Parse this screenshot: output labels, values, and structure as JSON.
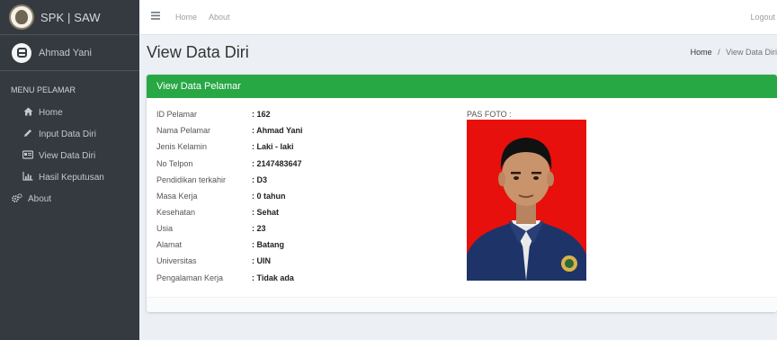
{
  "brand": {
    "title": "SPK | SAW"
  },
  "user": {
    "name": "Ahmad Yani"
  },
  "sidebar": {
    "header": "MENU PELAMAR",
    "items": [
      {
        "label": "Home",
        "icon": "home-icon"
      },
      {
        "label": "Input Data Diri",
        "icon": "pencil-icon"
      },
      {
        "label": "View Data Diri",
        "icon": "id-card-icon"
      },
      {
        "label": "Hasil Keputusan",
        "icon": "bar-chart-icon"
      },
      {
        "label": "About",
        "icon": "cogs-icon"
      }
    ]
  },
  "topnav": {
    "home": "Home",
    "about": "About",
    "logout": "Logout"
  },
  "page": {
    "title": "View Data Diri"
  },
  "breadcrumb": {
    "home": "Home",
    "separator": "/",
    "current": "View Data Diri"
  },
  "card": {
    "title": "View Data Pelamar",
    "accent": "#28a745",
    "photo_label": "PAS FOTO :",
    "fields": [
      {
        "label": "ID Pelamar",
        "value": ": 162"
      },
      {
        "label": "Nama Pelamar",
        "value": ": Ahmad Yani"
      },
      {
        "label": "Jenis Kelamin",
        "value": ": Laki - laki"
      },
      {
        "label": "No Telpon",
        "value": ": 2147483647"
      },
      {
        "label": "Pendidikan terkahir",
        "value": ": D3"
      },
      {
        "label": "Masa Kerja",
        "value": ": 0 tahun"
      },
      {
        "label": "Kesehatan",
        "value": ": Sehat"
      },
      {
        "label": "Usia",
        "value": ": 23"
      },
      {
        "label": "Alamat",
        "value": ": Batang"
      },
      {
        "label": "Universitas",
        "value": ": UIN"
      },
      {
        "label": "Pengalaman Kerja",
        "value": ": Tidak ada"
      }
    ]
  },
  "colors": {
    "sidebar": "#343a40",
    "photo_background": "#e8100c",
    "content_background": "#ecf0f5"
  }
}
